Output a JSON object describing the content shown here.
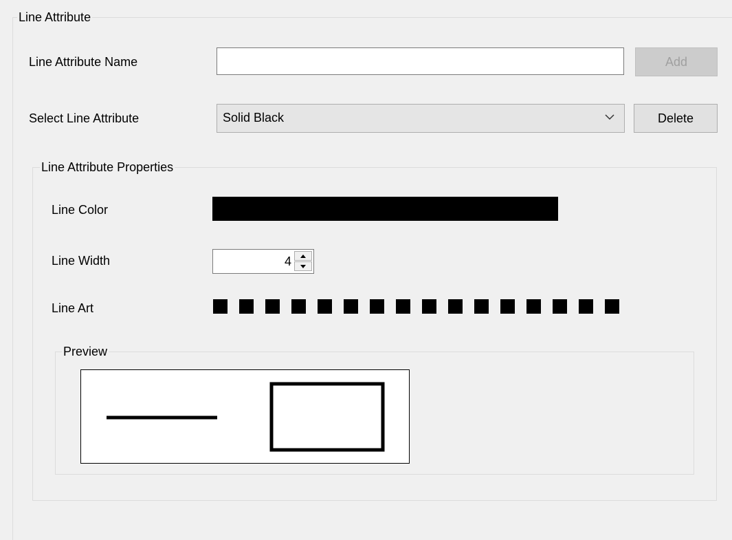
{
  "group": {
    "title": "Line Attribute",
    "name_label": "Line Attribute Name",
    "name_value": "",
    "add_label": "Add",
    "select_label": "Select Line Attribute",
    "selected_attribute": "Solid Black",
    "delete_label": "Delete"
  },
  "properties": {
    "title": "Line Attribute Properties",
    "color_label": "Line Color",
    "line_color": "#000000",
    "width_label": "Line Width",
    "width_value": "4",
    "art_label": "Line Art"
  },
  "preview": {
    "title": "Preview"
  }
}
